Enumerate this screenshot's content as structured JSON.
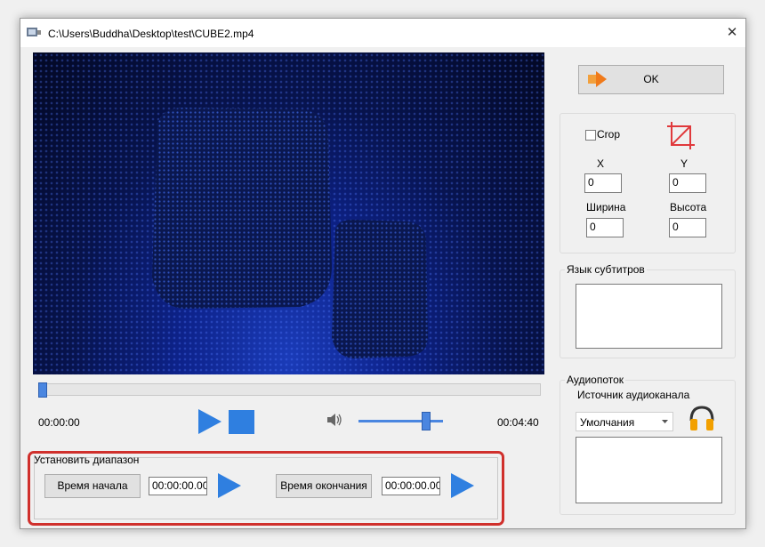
{
  "window": {
    "title": "C:\\Users\\Buddha\\Desktop\\test\\CUBE2.mp4",
    "close_glyph": "✕"
  },
  "player": {
    "current_time": "00:00:00",
    "total_time": "00:04:40",
    "seek_position": 0.0,
    "volume_level": 0.77
  },
  "range": {
    "label": "Установить диапазон",
    "start_button": "Время начала",
    "start_value": "00:00:00.00",
    "end_button": "Время окончания",
    "end_value": "00:00:00.00"
  },
  "ok_button": {
    "label": "OK"
  },
  "crop": {
    "checkbox_label": "Crop",
    "checked": false,
    "x_label": "X",
    "x_value": "0",
    "y_label": "Y",
    "y_value": "0",
    "width_label": "Ширина",
    "width_value": "0",
    "height_label": "Высота",
    "height_value": "0"
  },
  "subtitles": {
    "label": "Язык субтитров"
  },
  "audio": {
    "label": "Аудиопоток",
    "source_label": "Источник аудиоканала",
    "selected": "Умолчания"
  },
  "colors": {
    "accent": "#2f7fe0",
    "highlight": "#d0302c"
  },
  "icons": [
    "app-icon",
    "close-icon",
    "play-icon",
    "stop-icon",
    "volume-icon",
    "ok-arrow-icon",
    "crop-icon",
    "headphones-icon",
    "dropdown-arrow-icon"
  ]
}
